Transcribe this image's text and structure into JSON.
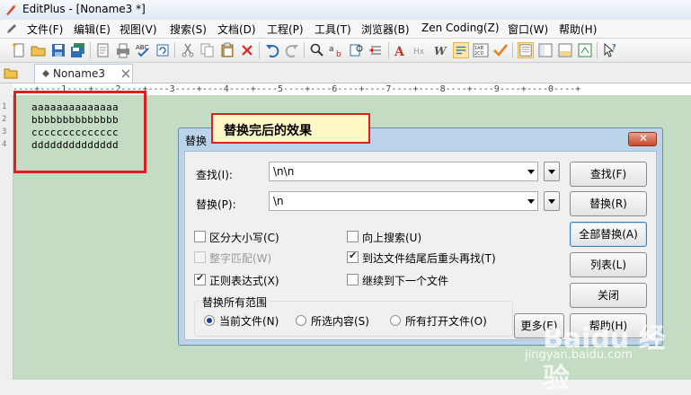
{
  "window": {
    "title": "EditPlus - [Noname3 *]"
  },
  "menu": [
    {
      "label": "文件(F)"
    },
    {
      "label": "编辑(E)"
    },
    {
      "label": "视图(V)"
    },
    {
      "label": "搜索(S)"
    },
    {
      "label": "文档(D)"
    },
    {
      "label": "工程(P)"
    },
    {
      "label": "工具(T)"
    },
    {
      "label": "浏览器(B)"
    },
    {
      "label": "Zen Coding(Z)"
    },
    {
      "label": "窗口(W)"
    },
    {
      "label": "帮助(H)"
    }
  ],
  "tabs": [
    {
      "label": "Noname3"
    }
  ],
  "ruler": {
    "text": "----+----1----+----2----+----3----+----4----+----5----+----6----+----7----+----8----+----9----+----0----+"
  },
  "editor": {
    "lines": [
      "aaaaaaaaaaaaaa",
      "bbbbbbbbbbbbbb",
      "cccccccccccccc",
      "dddddddddddddd"
    ]
  },
  "annotation": {
    "text": "替换完后的效果"
  },
  "dialog": {
    "title": "替换",
    "find_label": "查找(I):",
    "find_value": "\\n\\n",
    "replace_label": "替换(P):",
    "replace_value": "\\n",
    "options": {
      "match_case": "区分大小写(C)",
      "whole_word": "整字匹配(W)",
      "regex": "正则表达式(X)",
      "search_up": "向上搜索(U)",
      "wrap_around": "到达文件结尾后重头再找(T)",
      "next_file": "继续到下一个文件"
    },
    "scope": {
      "title": "替换所有范围",
      "current_file": "当前文件(N)",
      "selection": "所选内容(S)",
      "all_open": "所有打开文件(O)"
    },
    "buttons": {
      "find": "查找(F)",
      "replace": "替换(R)",
      "replace_all": "全部替换(A)",
      "list": "列表(L)",
      "close": "关闭",
      "more": "更多(E)",
      "help": "帮助(H)"
    }
  },
  "watermark": {
    "logo": "Baidu 经验",
    "site": "jingyan.baidu.com"
  }
}
